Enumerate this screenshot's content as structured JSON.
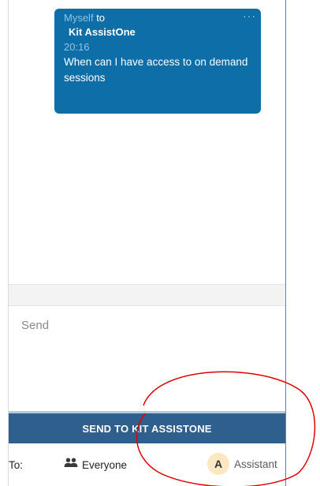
{
  "message": {
    "sender": "Myself",
    "to_word": "to",
    "recipient": "Kit AssistOne",
    "time": "20:16",
    "text": "When can I have access to on demand sessions",
    "more_icon": "more-dots-icon"
  },
  "composer": {
    "placeholder": "Send",
    "send_button": "SEND TO KIT ASSISTONE"
  },
  "recipients": {
    "to_label": "To:",
    "everyone": {
      "label": "Everyone",
      "icon": "users-icon"
    },
    "assistant": {
      "label": "Assistant",
      "avatar": "A"
    }
  },
  "colors": {
    "bubble": "#0e6fa8",
    "send_bar": "#2f5f8d",
    "annotation": "#e00000"
  }
}
